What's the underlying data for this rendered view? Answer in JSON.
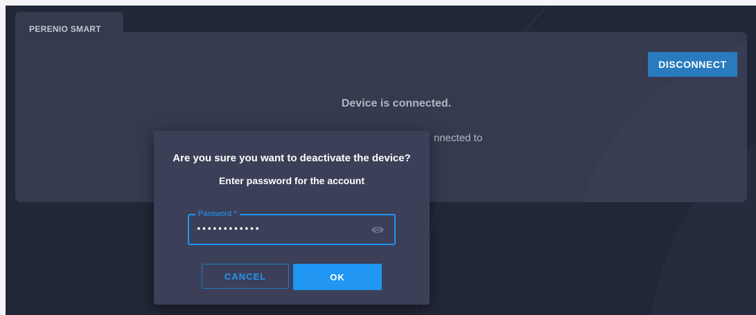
{
  "tab": {
    "label": "PERENIO SMART"
  },
  "panel": {
    "disconnect_label": "DISCONNECT",
    "status": "Device is connected.",
    "description_visible": "nnected to"
  },
  "dialog": {
    "title": "Are you sure you want to deactivate the device?",
    "subtitle": "Enter password for the account",
    "password_label": "Password *",
    "password_value": "1234567890ab",
    "cancel_label": "CANCEL",
    "ok_label": "OK"
  },
  "icons": {
    "password_visibility": "eye-icon"
  },
  "colors": {
    "background": "#222738",
    "panel": "#353a4f",
    "dialog": "#3b4058",
    "accent": "#2196f3",
    "disconnect": "#2a7bbd"
  }
}
